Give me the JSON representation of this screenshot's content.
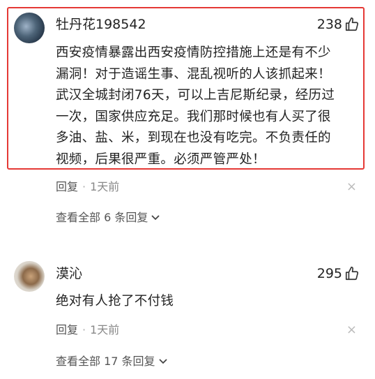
{
  "comments": [
    {
      "username": "牡丹花198542",
      "likes": "238",
      "lines": [
        "西安疫情暴露出西安疫情防控措施上还是有不少",
        "漏洞！对于造谣生事、混乱视听的人该抓起来！",
        "武汉全城封闭76天，可以上吉尼斯纪录，经历过",
        "一次，国家供应充足。我们那时候也有人买了很",
        "多油、盐、米，到现在也没有吃完。不负责任的",
        "视频，后果很严重。必须严管严处！"
      ],
      "reply_label": "回复",
      "time": "1天前",
      "close_glyph": "×",
      "view_all": "查看全部 6 条回复"
    },
    {
      "username": "漠沁",
      "likes": "295",
      "lines": [
        "绝对有人抢了不付钱"
      ],
      "reply_label": "回复",
      "time": "1天前",
      "close_glyph": "×",
      "view_all": "查看全部 17 条回复"
    }
  ],
  "icons": {
    "like": "thumbs-up-icon",
    "expand": "chevron-down-icon",
    "dismiss": "close-icon"
  },
  "colors": {
    "highlight": "#e53935",
    "text": "#222222",
    "meta": "#888888"
  }
}
